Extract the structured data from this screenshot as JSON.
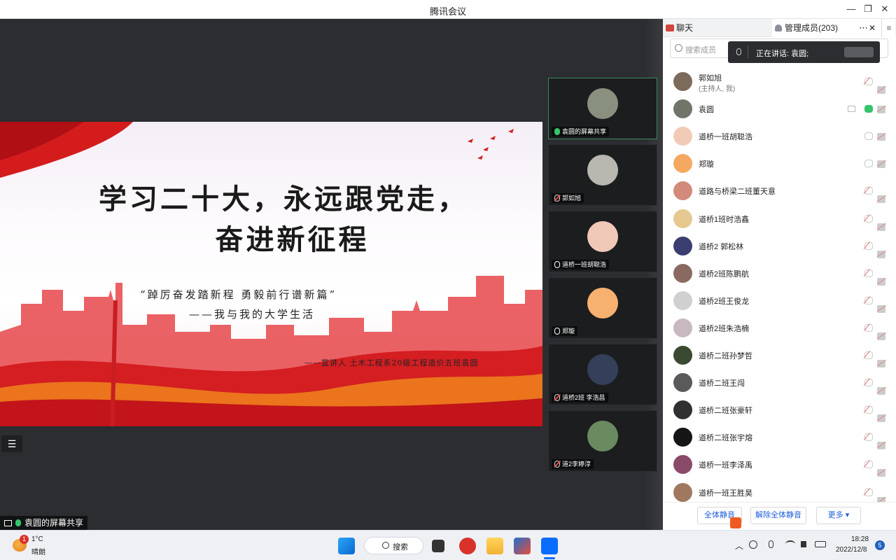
{
  "window": {
    "title": "腾讯会议",
    "min": "—",
    "restore": "❐",
    "close": "✕"
  },
  "slide": {
    "title_line1": "学习二十大，永远跟党走，",
    "title_line2": "奋进新征程",
    "quote": "“踔厉奋发踏新程 勇毅前行谱新篇”",
    "subtitle": "——我与我的大学生活",
    "presenter": "——宣讲人 土木工程系20级工程造价五班袁圆"
  },
  "stage": {
    "share_label": "袁圆的屏幕共享",
    "menu_icon": "☰"
  },
  "filmstrip": [
    {
      "name": "袁圆的屏幕共享",
      "mic": "green",
      "active": true,
      "color": "#8a9080"
    },
    {
      "name": "郭如旭",
      "mic": "off",
      "active": false,
      "color": "#b8b8b0"
    },
    {
      "name": "道桥一班胡聪浩",
      "mic": "on",
      "active": false,
      "color": "#f0c8b8"
    },
    {
      "name": "郑璇",
      "mic": "on",
      "active": false,
      "color": "#f6b070"
    },
    {
      "name": "道桥2班 李浩昌",
      "mic": "off",
      "active": false,
      "color": "#34405a"
    },
    {
      "name": "道2李婷淳",
      "mic": "off",
      "active": false,
      "color": "#6a8a60"
    }
  ],
  "panel": {
    "tab_chat": "聊天",
    "tab_members": "管理成员(203)",
    "more": "⋯",
    "close": "✕",
    "list_icon": "≡",
    "search_placeholder": "搜索成员",
    "speaking_label": "正在讲话: 袁圆;",
    "members": [
      {
        "name": "郭如旭",
        "sub": "(主持人, 我)",
        "mic": "off",
        "screen": false,
        "color": "#7c6a5a"
      },
      {
        "name": "袁圆",
        "sub": "",
        "mic": "green",
        "screen": true,
        "color": "#6f7568"
      },
      {
        "name": "道桥一班胡聪浩",
        "sub": "",
        "mic": "on",
        "screen": false,
        "color": "#f2cbb8"
      },
      {
        "name": "郑璇",
        "sub": "",
        "mic": "on",
        "screen": false,
        "color": "#f4a860"
      },
      {
        "name": "道路与桥梁二班董天意",
        "sub": "",
        "mic": "off",
        "screen": false,
        "color": "#d28a7a"
      },
      {
        "name": "道桥1班时浩鑫",
        "sub": "",
        "mic": "off",
        "screen": false,
        "color": "#e6c890"
      },
      {
        "name": "道桥2 郭松林",
        "sub": "",
        "mic": "off",
        "screen": false,
        "color": "#3a3e70"
      },
      {
        "name": "道桥2班陈鹏航",
        "sub": "",
        "mic": "off",
        "screen": false,
        "color": "#8a6a60"
      },
      {
        "name": "道桥2班王俊龙",
        "sub": "",
        "mic": "off",
        "screen": false,
        "color": "#d0d0d0"
      },
      {
        "name": "道桥2班朱浩楠",
        "sub": "",
        "mic": "off",
        "screen": false,
        "color": "#c8b8c0"
      },
      {
        "name": "道桥二班孙梦哲",
        "sub": "",
        "mic": "off",
        "screen": false,
        "color": "#3a4a30"
      },
      {
        "name": "道桥二班王闯",
        "sub": "",
        "mic": "off",
        "screen": false,
        "color": "#5a5a5a"
      },
      {
        "name": "道桥二班张豪轩",
        "sub": "",
        "mic": "off",
        "screen": false,
        "color": "#303030"
      },
      {
        "name": "道桥二班张宇熔",
        "sub": "",
        "mic": "off",
        "screen": false,
        "color": "#151515"
      },
      {
        "name": "道桥一班李泽禹",
        "sub": "",
        "mic": "off",
        "screen": false,
        "color": "#8a4a6a"
      },
      {
        "name": "道桥一班王胜昊",
        "sub": "",
        "mic": "off",
        "screen": false,
        "color": "#a07860"
      }
    ],
    "mute_all": "全体静音",
    "unmute_all": "解除全体静音",
    "more_btn": "更多 ▾"
  },
  "taskbar": {
    "weather_temp": "1°C",
    "weather_desc": "晴朗",
    "weather_badge": "1",
    "search": "搜索",
    "time": "18:28",
    "date": "2022/12/8",
    "notify": "5"
  }
}
